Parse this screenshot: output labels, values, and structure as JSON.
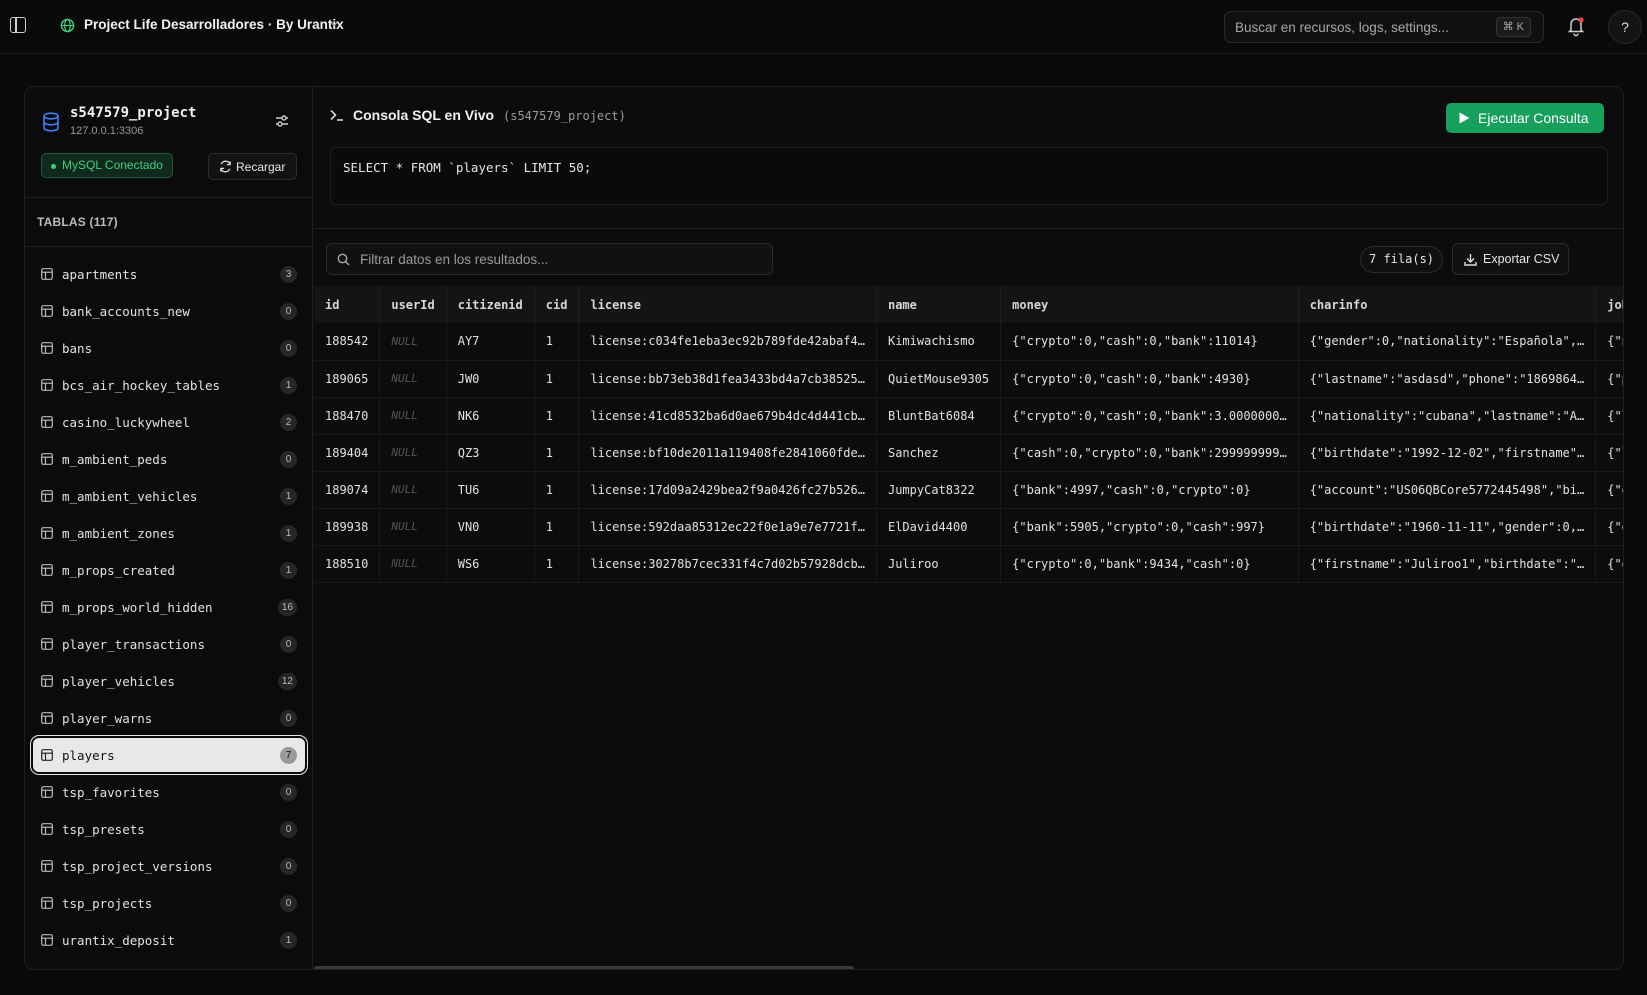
{
  "topbar": {
    "project_name": "Project Life Desarrolladores · By Urantix",
    "search_placeholder": "Buscar en recursos, logs, settings...",
    "search_shortcut": "⌘ K",
    "help_label": "?"
  },
  "database": {
    "name": "s547579_project",
    "host": "127.0.0.1:3306",
    "status": "MySQL Conectado",
    "reload_label": "Recargar"
  },
  "tables_header": "TABLAS (117)",
  "tables": [
    {
      "name": "apartments",
      "count": "3"
    },
    {
      "name": "bank_accounts_new",
      "count": "0"
    },
    {
      "name": "bans",
      "count": "0"
    },
    {
      "name": "bcs_air_hockey_tables",
      "count": "1"
    },
    {
      "name": "casino_luckywheel",
      "count": "2"
    },
    {
      "name": "m_ambient_peds",
      "count": "0"
    },
    {
      "name": "m_ambient_vehicles",
      "count": "1"
    },
    {
      "name": "m_ambient_zones",
      "count": "1"
    },
    {
      "name": "m_props_created",
      "count": "1"
    },
    {
      "name": "m_props_world_hidden",
      "count": "16"
    },
    {
      "name": "player_transactions",
      "count": "0"
    },
    {
      "name": "player_vehicles",
      "count": "12"
    },
    {
      "name": "player_warns",
      "count": "0"
    },
    {
      "name": "players",
      "count": "7",
      "active": true
    },
    {
      "name": "tsp_favorites",
      "count": "0"
    },
    {
      "name": "tsp_presets",
      "count": "0"
    },
    {
      "name": "tsp_project_versions",
      "count": "0"
    },
    {
      "name": "tsp_projects",
      "count": "0"
    },
    {
      "name": "urantix_deposit",
      "count": "1"
    }
  ],
  "console": {
    "title": "Consola SQL en Vivo",
    "subtitle": "(s547579_project)",
    "run_label": "Ejecutar Consulta",
    "query": "SELECT * FROM `players` LIMIT 50;"
  },
  "results": {
    "filter_placeholder": "Filtrar datos en los resultados...",
    "rows_label": "7 fila(s)",
    "export_label": "Exportar CSV",
    "columns": [
      "id",
      "userId",
      "citizenid",
      "cid",
      "license",
      "name",
      "money",
      "charinfo",
      "job"
    ],
    "rows": [
      [
        "188542",
        "NULL",
        "AY7",
        "1",
        "license:c034fe1eba3ec92b789fde42abaf4…",
        "Kimiwachismo",
        "{\"crypto\":0,\"cash\":0,\"bank\":11014}",
        "{\"gender\":0,\"nationality\":\"Española\",…",
        "{\"n"
      ],
      [
        "189065",
        "NULL",
        "JW0",
        "1",
        "license:bb73eb38d1fea3433bd4a7cb38525…",
        "QuietMouse9305",
        "{\"crypto\":0,\"cash\":0,\"bank\":4930}",
        "{\"lastname\":\"asdasd\",\"phone\":\"1869864…",
        "{\"p"
      ],
      [
        "188470",
        "NULL",
        "NK6",
        "1",
        "license:41cd8532ba6d0ae679b4dc4d441cb…",
        "BluntBat6084",
        "{\"crypto\":0,\"cash\":0,\"bank\":3.0000000…",
        "{\"nationality\":\"cubana\",\"lastname\":\"A…",
        "{\"l"
      ],
      [
        "189404",
        "NULL",
        "QZ3",
        "1",
        "license:bf10de2011a119408fe2841060fde…",
        "Sanchez",
        "{\"cash\":0,\"crypto\":0,\"bank\":299999999…",
        "{\"birthdate\":\"1992-12-02\",\"firstname\"…",
        "{\"l"
      ],
      [
        "189074",
        "NULL",
        "TU6",
        "1",
        "license:17d09a2429bea2f9a0426fc27b526…",
        "JumpyCat8322",
        "{\"bank\":4997,\"cash\":0,\"crypto\":0}",
        "{\"account\":\"US06QBCore5772445498\",\"bi…",
        "{\"o"
      ],
      [
        "189938",
        "NULL",
        "VN0",
        "1",
        "license:592daa85312ec22f0e1a9e7e7721f…",
        "ElDavid4400",
        "{\"bank\":5905,\"crypto\":0,\"cash\":997}",
        "{\"birthdate\":\"1960-11-11\",\"gender\":0,…",
        "{\"o"
      ],
      [
        "188510",
        "NULL",
        "WS6",
        "1",
        "license:30278b7cec331f4c7d02b57928dcb…",
        "Juliroo",
        "{\"crypto\":0,\"bank\":9434,\"cash\":0}",
        "{\"firstname\":\"Juliroo1\",\"birthdate\":\"…",
        "{\"o"
      ]
    ]
  },
  "colors": {
    "accent_green": "#16a05c",
    "status_green": "#3ecf7c",
    "db_icon_blue": "#3b82f6"
  }
}
